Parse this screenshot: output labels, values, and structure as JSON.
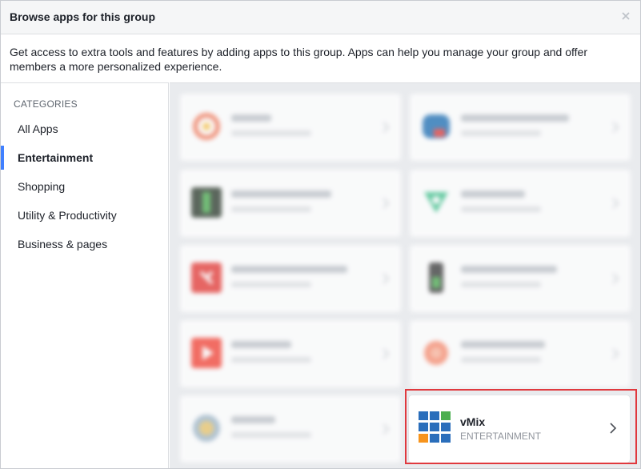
{
  "dialog": {
    "title": "Browse apps for this group",
    "description": "Get access to extra tools and features by adding apps to this group. Apps can help you manage your group and offer members a more personalized experience."
  },
  "sidebar": {
    "heading": "CATEGORIES",
    "items": [
      {
        "label": "All Apps",
        "active": false
      },
      {
        "label": "Entertainment",
        "active": true
      },
      {
        "label": "Shopping",
        "active": false
      },
      {
        "label": "Utility & Productivity",
        "active": false
      },
      {
        "label": "Business & pages",
        "active": false
      }
    ]
  },
  "apps": {
    "featured": {
      "name": "vMix",
      "category": "ENTERTAINMENT"
    }
  },
  "colors": {
    "accent": "#4080ff",
    "highlight": "#e0393e",
    "vmix_blue": "#2a6ebb",
    "vmix_green": "#4caf50",
    "vmix_orange": "#f7941d"
  }
}
